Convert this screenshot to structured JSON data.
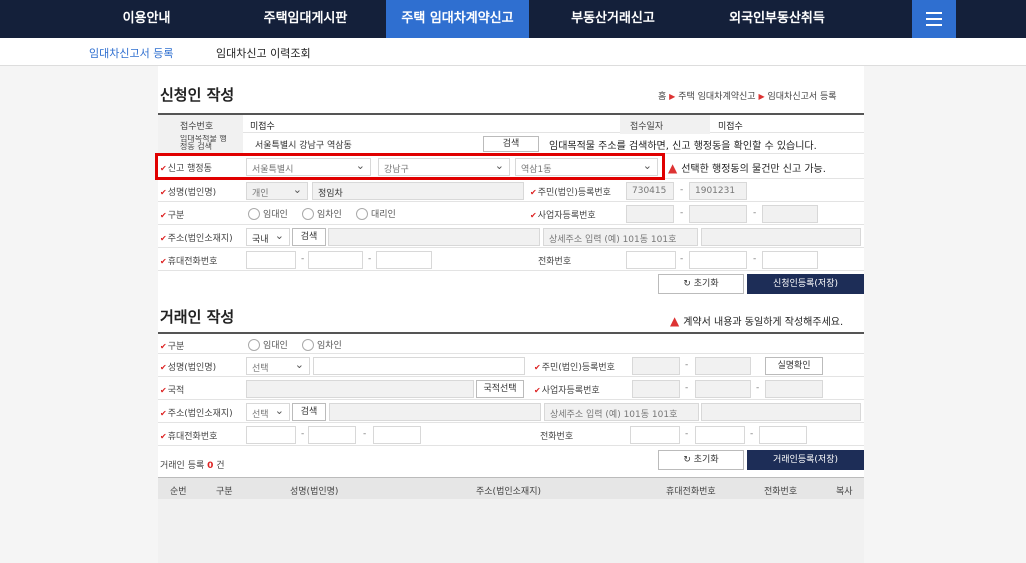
{
  "nav": {
    "items": [
      "이용안내",
      "주택임대게시판",
      "주택 임대차계약신고",
      "부동산거래신고",
      "외국인부동산취득"
    ],
    "active_index": 2
  },
  "subnav": {
    "item1": "임대차신고서 등록",
    "item2": "임대차신고 이력조회"
  },
  "applicant": {
    "title": "신청인 작성",
    "breadcrumb": {
      "home": "홈",
      "level1": "주택 임대차계약신고",
      "level2": "임대차신고서 등록"
    },
    "receipt_no_label": "접수번호",
    "receipt_no_value": "미접수",
    "receipt_date_label": "접수일자",
    "receipt_date_value": "미접수",
    "search_address_label": "임대목적물 행정동 검색",
    "search_address_value": "서울특별시 강남구 역삼동",
    "search_button": "검색",
    "search_notice": "임대목적물 주소를 검색하면, 신고 행정동을 확인할 수 있습니다.",
    "admin_label": "신고 행정동",
    "admin_city": "서울특별시",
    "admin_district": "강남구",
    "admin_dong": "역삼1동",
    "admin_warning": "선택한 행정동의 물건만 신고 가능.",
    "name_label": "성명(법인명)",
    "person_type": "개인",
    "name_value": "정임차",
    "rrn_label": "주민(법인)등록번호",
    "rrn_front": "730415",
    "rrn_back": "1901231",
    "type_label": "구분",
    "type_options": [
      "임대인",
      "임차인",
      "대리인"
    ],
    "biz_label": "사업자등록번호",
    "addr_label": "주소(법인소재지)",
    "addr_country": "국내",
    "addr_search": "검색",
    "addr_detail_placeholder": "상세주소 입력 (예) 101동 101호",
    "mobile_label": "휴대전화번호",
    "phone_label": "전화번호",
    "reset_button": "초기화",
    "save_button": "신청인등록(저장)"
  },
  "counterparty": {
    "title": "거래인 작성",
    "warning": "계약서 내용과 동일하게 작성해주세요.",
    "type_label": "구분",
    "type_options": [
      "임대인",
      "임차인"
    ],
    "name_label": "성명(법인명)",
    "person_type": "선택",
    "rrn_label": "주민(법인)등록번호",
    "verify_button": "실명확인",
    "nation_label": "국적",
    "nation_button": "국적선택",
    "biz_label": "사업자등록번호",
    "addr_label": "주소(법인소재지)",
    "addr_country": "선택",
    "addr_search": "검색",
    "addr_detail_placeholder": "상세주소 입력 (예) 101동 101호",
    "mobile_label": "휴대전화번호",
    "phone_label": "전화번호",
    "reset_button": "초기화",
    "save_button": "거래인등록(저장)",
    "count_prefix": "거래인 등록",
    "count_value": "0",
    "count_suffix": "건"
  },
  "table": {
    "headers": [
      "순번",
      "구분",
      "성명(법인명)",
      "주소(법인소재지)",
      "휴대전화번호",
      "전화번호",
      "복사"
    ]
  },
  "colors": {
    "nav_bg": "#14203a",
    "accent": "#2f6fd0",
    "button_dark": "#1d2d57",
    "highlight": "#e00000"
  }
}
